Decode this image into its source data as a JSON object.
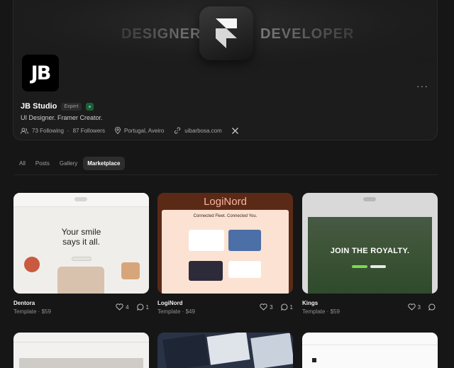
{
  "banner": {
    "left_text": "DESIGNER",
    "right_text": "DEVELOPER",
    "logo_icon": "framer-logo-icon"
  },
  "profile": {
    "avatar_text": "JB",
    "name": "JB Studio",
    "badge": "Expert",
    "bio": "UI Designer. Framer Creator.",
    "following": "73 Following",
    "separator": "·",
    "followers": "87 Followers",
    "location": "Portugal, Aveiro",
    "website": "uibarbosa.com",
    "more_label": "···"
  },
  "tabs": [
    {
      "label": "All",
      "active": false
    },
    {
      "label": "Posts",
      "active": false
    },
    {
      "label": "Gallery",
      "active": false
    },
    {
      "label": "Marketplace",
      "active": true
    }
  ],
  "cards": [
    {
      "title": "Dentora",
      "subtitle": "Template · $59",
      "likes": "4",
      "comments": "1",
      "thumb_headline_1": "Your smile",
      "thumb_headline_2": "says it all."
    },
    {
      "title": "LogiNord",
      "subtitle": "Template · $49",
      "likes": "3",
      "comments": "1",
      "thumb_logo": "LogiNord",
      "thumb_headline": "Connected Fleet. Connected You."
    },
    {
      "title": "Kings",
      "subtitle": "Template · $59",
      "likes": "3",
      "comments": "",
      "thumb_headline": "JOIN THE ROYALTY."
    }
  ],
  "colors": {
    "background": "#161616",
    "card": "#1c1c1c",
    "verified": "#4fd188",
    "loginord_brand": "#5b2a17"
  }
}
